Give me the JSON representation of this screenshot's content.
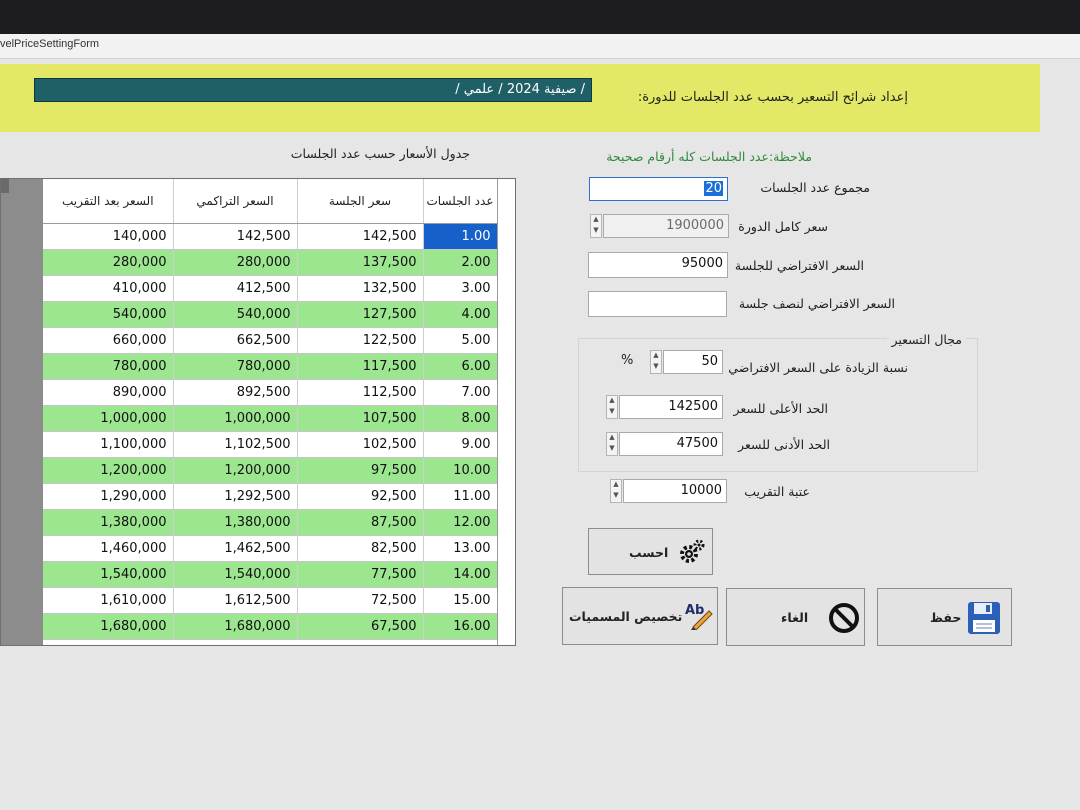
{
  "window": {
    "title": "velPriceSettingForm"
  },
  "banner": {
    "title": "إعداد شرائح التسعير بحسب عدد الجلسات للدورة:",
    "course": "/ صيفية 2024 / علمي /"
  },
  "note": "ملاحظة:عدد الجلسات كله أرقام صحيحة",
  "grid": {
    "title": "جدول الأسعار حسب عدد الجلسات",
    "headers": {
      "sessions": "عدد الجلسات",
      "session_price": "سعر الجلسة",
      "cumulative": "السعر التراكمي",
      "rounded": "السعر بعد التقريب"
    },
    "rows": [
      {
        "sessions": "1.00",
        "price": "142,500",
        "cumulative": "142,500",
        "rounded": "140,000"
      },
      {
        "sessions": "2.00",
        "price": "137,500",
        "cumulative": "280,000",
        "rounded": "280,000"
      },
      {
        "sessions": "3.00",
        "price": "132,500",
        "cumulative": "412,500",
        "rounded": "410,000"
      },
      {
        "sessions": "4.00",
        "price": "127,500",
        "cumulative": "540,000",
        "rounded": "540,000"
      },
      {
        "sessions": "5.00",
        "price": "122,500",
        "cumulative": "662,500",
        "rounded": "660,000"
      },
      {
        "sessions": "6.00",
        "price": "117,500",
        "cumulative": "780,000",
        "rounded": "780,000"
      },
      {
        "sessions": "7.00",
        "price": "112,500",
        "cumulative": "892,500",
        "rounded": "890,000"
      },
      {
        "sessions": "8.00",
        "price": "107,500",
        "cumulative": "1,000,000",
        "rounded": "1,000,000"
      },
      {
        "sessions": "9.00",
        "price": "102,500",
        "cumulative": "1,102,500",
        "rounded": "1,100,000"
      },
      {
        "sessions": "10.00",
        "price": "97,500",
        "cumulative": "1,200,000",
        "rounded": "1,200,000"
      },
      {
        "sessions": "11.00",
        "price": "92,500",
        "cumulative": "1,292,500",
        "rounded": "1,290,000"
      },
      {
        "sessions": "12.00",
        "price": "87,500",
        "cumulative": "1,380,000",
        "rounded": "1,380,000"
      },
      {
        "sessions": "13.00",
        "price": "82,500",
        "cumulative": "1,462,500",
        "rounded": "1,460,000"
      },
      {
        "sessions": "14.00",
        "price": "77,500",
        "cumulative": "1,540,000",
        "rounded": "1,540,000"
      },
      {
        "sessions": "15.00",
        "price": "72,500",
        "cumulative": "1,612,500",
        "rounded": "1,610,000"
      },
      {
        "sessions": "16.00",
        "price": "67,500",
        "cumulative": "1,680,000",
        "rounded": "1,680,000"
      }
    ]
  },
  "form": {
    "total_sessions": {
      "label": "مجموع عدد الجلسات",
      "value": "20"
    },
    "course_price": {
      "label": "سعر كامل الدورة",
      "value": "1900000"
    },
    "default_session_price": {
      "label": "السعر الافتراضي للجلسة",
      "value": "95000"
    },
    "half_session_price": {
      "label": "السعر الافتراضي لنصف جلسة",
      "value": ""
    },
    "pricing_range": {
      "title": "مجال التسعير",
      "increase_pct": {
        "label": "نسبة الزيادة على السعر الافتراضي",
        "value": "50",
        "unit": "%"
      },
      "max_price": {
        "label": "الحد الأعلى للسعر",
        "value": "142500"
      },
      "min_price": {
        "label": "الحد الأدنى للسعر",
        "value": "47500"
      }
    },
    "rounding": {
      "label": "عتبة التقريب",
      "value": "10000"
    }
  },
  "buttons": {
    "calculate": "احسب",
    "save": "حفظ",
    "cancel": "الغاء",
    "customize_names": "تخصيص المسميات",
    "customize_icon_text": "Ab"
  },
  "colors": {
    "banner": "#e3e866",
    "course_box": "#1f5f66",
    "row_green": "#9be68f",
    "selection": "#1561c9"
  }
}
